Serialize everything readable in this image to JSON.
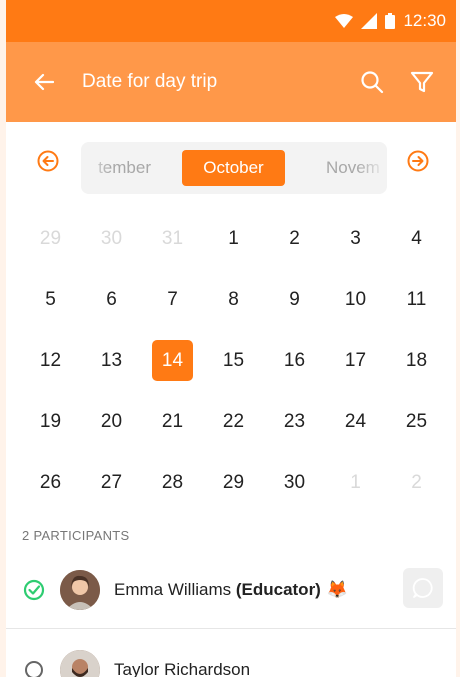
{
  "status_bar": {
    "time": "12:30"
  },
  "app_bar": {
    "title": "Date for day trip"
  },
  "month_nav": {
    "prev": "tember",
    "current": "October",
    "next": "Novem"
  },
  "calendar": {
    "weeks": [
      [
        {
          "d": "29",
          "muted": true
        },
        {
          "d": "30",
          "muted": true
        },
        {
          "d": "31",
          "muted": true
        },
        {
          "d": "1"
        },
        {
          "d": "2"
        },
        {
          "d": "3"
        },
        {
          "d": "4"
        }
      ],
      [
        {
          "d": "5"
        },
        {
          "d": "6"
        },
        {
          "d": "7"
        },
        {
          "d": "8"
        },
        {
          "d": "9"
        },
        {
          "d": "10"
        },
        {
          "d": "11"
        }
      ],
      [
        {
          "d": "12"
        },
        {
          "d": "13"
        },
        {
          "d": "14",
          "selected": true
        },
        {
          "d": "15"
        },
        {
          "d": "16"
        },
        {
          "d": "17"
        },
        {
          "d": "18"
        }
      ],
      [
        {
          "d": "19"
        },
        {
          "d": "20"
        },
        {
          "d": "21"
        },
        {
          "d": "22"
        },
        {
          "d": "23"
        },
        {
          "d": "24"
        },
        {
          "d": "25"
        }
      ],
      [
        {
          "d": "26"
        },
        {
          "d": "27"
        },
        {
          "d": "28"
        },
        {
          "d": "29"
        },
        {
          "d": "30"
        },
        {
          "d": "1",
          "muted": true
        },
        {
          "d": "2",
          "muted": true
        }
      ]
    ]
  },
  "participants": {
    "header": "2 PARTICIPANTS",
    "list": [
      {
        "name": "Emma Williams",
        "role": "(Educator)",
        "emoji": "🦊",
        "checked": true
      },
      {
        "name": "Taylor Richardson",
        "role": "",
        "emoji": "",
        "checked": false
      }
    ]
  },
  "colors": {
    "accent": "#ff7a14",
    "app_bar": "#ff9849",
    "check": "#2ecc71"
  }
}
